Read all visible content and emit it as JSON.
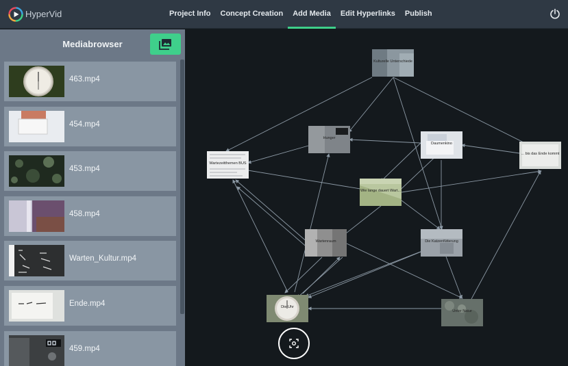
{
  "app": {
    "name": "HyperVid"
  },
  "nav": {
    "tabs": [
      {
        "label": "Project Info"
      },
      {
        "label": "Concept Creation"
      },
      {
        "label": "Add Media"
      },
      {
        "label": "Edit Hyperlinks"
      },
      {
        "label": "Publish"
      }
    ],
    "active_tab": "Add Media"
  },
  "sidebar": {
    "title": "Mediabrowser",
    "items": [
      {
        "label": "463.mp4"
      },
      {
        "label": "454.mp4"
      },
      {
        "label": "453.mp4"
      },
      {
        "label": "458.mp4"
      },
      {
        "label": "Warten_Kultur.mp4"
      },
      {
        "label": "Ende.mp4"
      },
      {
        "label": "459.mp4"
      }
    ]
  },
  "graph": {
    "nodes": [
      {
        "label": "Kulturelle Unterschiede"
      },
      {
        "label": "Hunger"
      },
      {
        "label": "Daumenkino"
      },
      {
        "label": "... bis das Ende kommt"
      },
      {
        "label": "Wartezeitthemen BUS"
      },
      {
        "label": "Wie lange dauert Wart..."
      },
      {
        "label": "Wartenraum"
      },
      {
        "label": "Die Katzenfütterung"
      },
      {
        "label": "Die Uhr"
      },
      {
        "label": "Unter Natur"
      }
    ]
  },
  "colors": {
    "accent": "#3ed08a",
    "topbar": "#2f3944",
    "sidebar": "#6c7887",
    "item": "#8996a3",
    "canvas": "#14191d"
  }
}
